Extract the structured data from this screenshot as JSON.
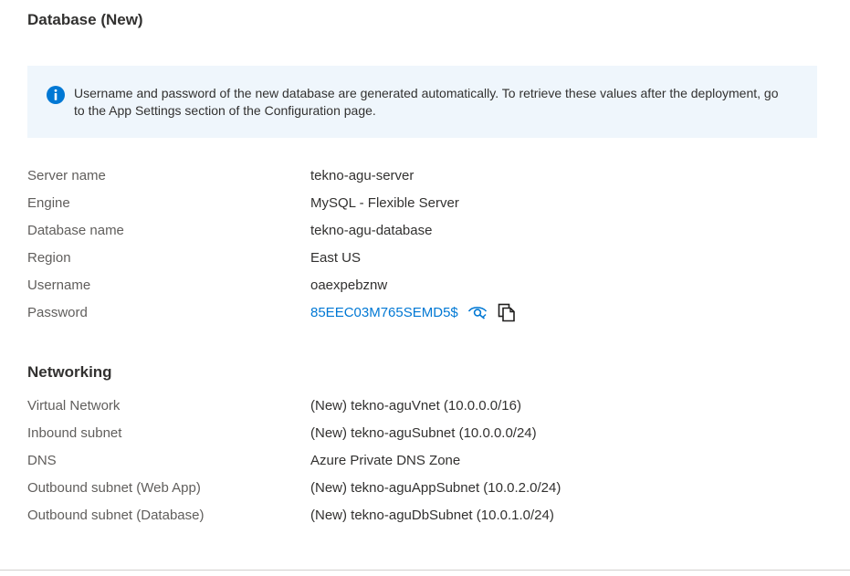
{
  "database_section": {
    "title": "Database (New)",
    "info_message": "Username and password of the new database are generated automatically. To retrieve these values after the deployment, go to the App Settings section of the Configuration page.",
    "fields": [
      {
        "label": "Server name",
        "value": "tekno-agu-server"
      },
      {
        "label": "Engine",
        "value": "MySQL - Flexible Server"
      },
      {
        "label": "Database name",
        "value": "tekno-agu-database"
      },
      {
        "label": "Region",
        "value": "East US"
      },
      {
        "label": "Username",
        "value": "oaexpebznw"
      },
      {
        "label": "Password",
        "value": "85EEC03M765SEMD5$"
      }
    ],
    "icons": {
      "info": "info-icon",
      "reveal": "eye-hide-icon",
      "copy": "copy-icon"
    }
  },
  "networking_section": {
    "title": "Networking",
    "fields": [
      {
        "label": "Virtual Network",
        "value": "(New) tekno-aguVnet (10.0.0.0/16)"
      },
      {
        "label": "Inbound subnet",
        "value": "(New) tekno-aguSubnet (10.0.0.0/24)"
      },
      {
        "label": "DNS",
        "value": "Azure Private DNS Zone"
      },
      {
        "label": "Outbound subnet (Web App)",
        "value": "(New) tekno-aguAppSubnet (10.0.2.0/24)"
      },
      {
        "label": "Outbound subnet (Database)",
        "value": "(New) tekno-aguDbSubnet (10.0.1.0/24)"
      }
    ]
  },
  "colors": {
    "link": "#0078d4",
    "info_background": "#eff6fc",
    "info_icon": "#0078d4",
    "label": "#605e5c",
    "text": "#323130"
  }
}
